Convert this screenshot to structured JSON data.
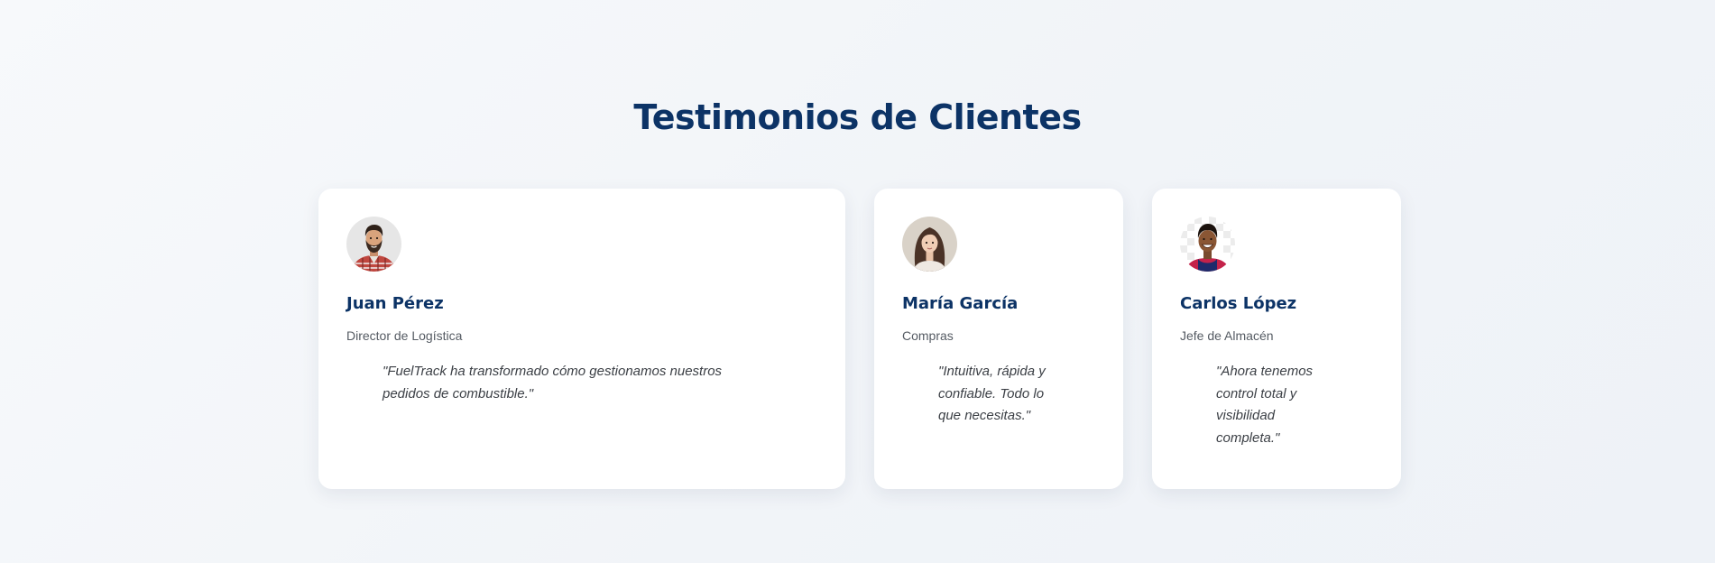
{
  "section": {
    "title": "Testimonios de Clientes"
  },
  "colors": {
    "title": "#0c3366",
    "card_background": "#ffffff",
    "page_background": "#f3f6f9"
  },
  "testimonials": [
    {
      "avatar_icon": "man-with-beard-plaid-shirt-avatar",
      "name": "Juan Pérez",
      "role": "Director de Logística",
      "quote": "\"FuelTrack ha transformado cómo gestionamos nuestros pedidos de combustible.\""
    },
    {
      "avatar_icon": "woman-with-long-hair-avatar",
      "name": "María García",
      "role": "Compras",
      "quote": "\"Intuitiva, rápida y confiable. Todo lo que necesitas.\""
    },
    {
      "avatar_icon": "smiling-man-jersey-avatar",
      "name": "Carlos López",
      "role": "Jefe de Almacén",
      "quote": "\"Ahora tenemos control total y visibilidad completa.\""
    }
  ]
}
